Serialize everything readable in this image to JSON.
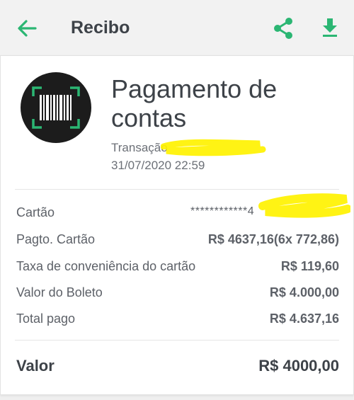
{
  "header": {
    "title": "Recibo",
    "back_icon": "arrow-left-icon",
    "share_icon": "share-icon",
    "download_icon": "download-icon",
    "accent_color": "#2bb673"
  },
  "receipt": {
    "icon": "barcode-icon",
    "heading": "Pagamento de contas",
    "transaction_label": "Transação",
    "date": "31/07/2020 22:59"
  },
  "details": [
    {
      "label": "Cartão",
      "value": "************4"
    },
    {
      "label": "Pagto. Cartão",
      "value": "R$ 4637,16(6x 772,86)"
    },
    {
      "label": "Taxa de conveniência do cartão",
      "value": "R$ 119,60"
    },
    {
      "label": "Valor do Boleto",
      "value": "R$ 4.000,00"
    },
    {
      "label": "Total pago",
      "value": "R$ 4.637,16"
    }
  ],
  "summary": {
    "label": "Valor",
    "value": "R$ 4000,00"
  }
}
